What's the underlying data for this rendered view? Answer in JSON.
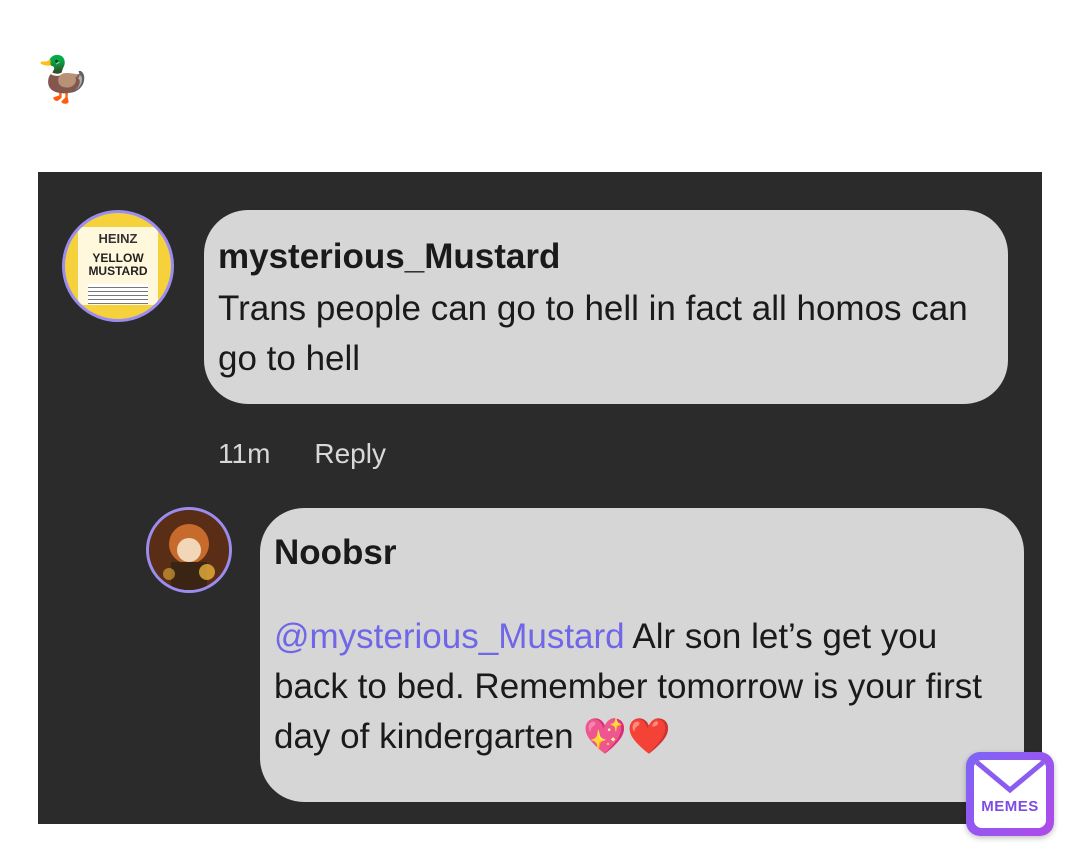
{
  "caption": {
    "emoji": "🦆"
  },
  "comment": {
    "username": "mysterious_Mustard",
    "text": "Trans people can go to hell in fact all homos can go to hell",
    "avatar_text": {
      "brand": "HEINZ",
      "product": "YELLOW MUSTARD"
    },
    "time": "11m",
    "reply_label": "Reply"
  },
  "reply": {
    "username": "Noobsr",
    "mention": "@mysterious_Mustard",
    "text": " Alr son let’s get you back to bed. Remember tomorrow is your first day of kindergarten 💖❤️"
  },
  "watermark": {
    "label": "MEMES"
  },
  "colors": {
    "panel": "#2b2b2b",
    "bubble": "#d6d6d6",
    "mention": "#6f66e8",
    "avatar_ring": "#9b8cf0"
  }
}
